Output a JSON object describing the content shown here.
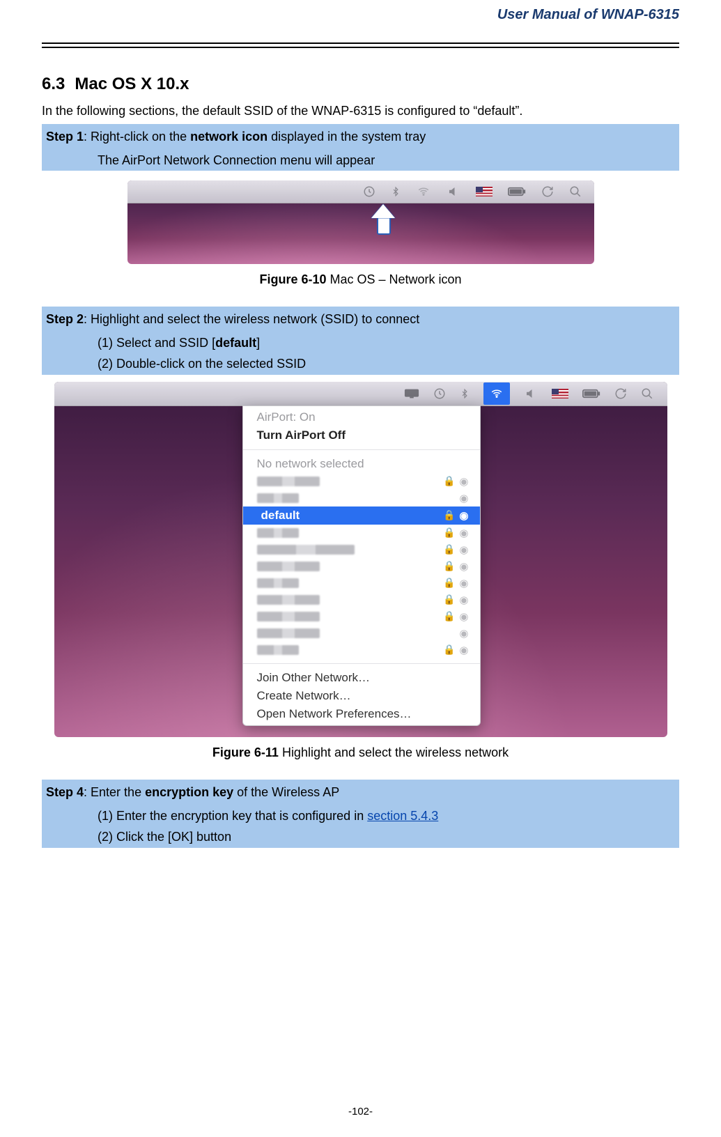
{
  "header": {
    "doc_title": "User Manual of WNAP-6315"
  },
  "section": {
    "number": "6.3",
    "title": "Mac OS X 10.x"
  },
  "intro": "In the following sections, the default SSID of the WNAP-6315 is configured to “default”.",
  "step1": {
    "label": "Step 1",
    "text_before": ": Right-click on the ",
    "bold": "network icon",
    "text_after": " displayed in the system tray",
    "sub": "The AirPort Network Connection menu will appear"
  },
  "fig610": {
    "label": "Figure 6-10",
    "caption": " Mac OS – Network icon"
  },
  "step2": {
    "label": "Step 2",
    "text": ": Highlight and select the wireless network (SSID) to connect",
    "sub1_pre": "(1)  Select and SSID [",
    "sub1_bold": "default",
    "sub1_post": "]",
    "sub2": "(2)  Double-click on the selected SSID"
  },
  "dropdown": {
    "airport_status": "AirPort: On",
    "turn_off": "Turn AirPort Off",
    "no_network": "No network selected",
    "selected_ssid": "default",
    "join_other": "Join Other Network…",
    "create_network": "Create Network…",
    "open_prefs": "Open Network Preferences…"
  },
  "fig611": {
    "label": "Figure 6-11",
    "caption": " Highlight and select the wireless network"
  },
  "step4": {
    "label": "Step 4",
    "text_before": ": Enter the ",
    "bold": "encryption key",
    "text_after": " of the Wireless AP",
    "sub1_pre": "(1)  Enter the encryption key that is configured in ",
    "sub1_link": "section 5.4.3",
    "sub2": "(2)  Click the [OK] button"
  },
  "footer": {
    "page": "-102-"
  }
}
